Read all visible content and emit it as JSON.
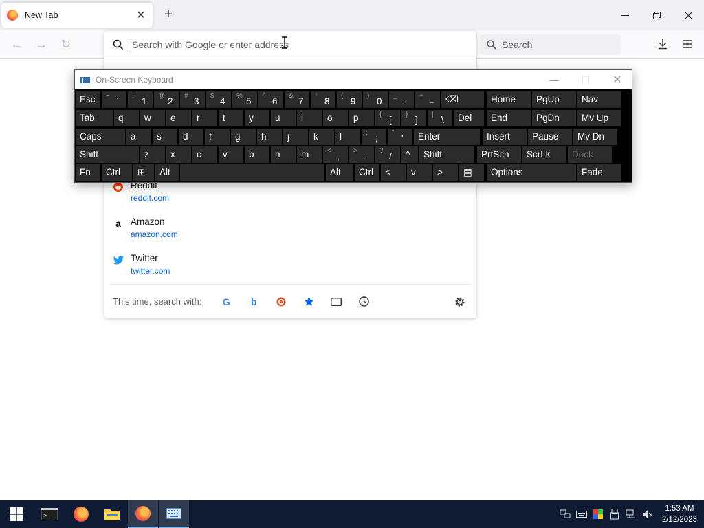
{
  "browser": {
    "tab_title": "New Tab",
    "url_placeholder": "Search with Google or enter address",
    "search_placeholder": "Search"
  },
  "suggestions": [
    {
      "name": "Reddit",
      "url": "reddit.com",
      "icon": "reddit-icon"
    },
    {
      "name": "Amazon",
      "url": "amazon.com",
      "icon": "amazon-icon"
    },
    {
      "name": "Twitter",
      "url": "twitter.com",
      "icon": "twitter-icon"
    }
  ],
  "oneoff": {
    "label": "This time, search with:",
    "engines": [
      "google-icon",
      "bing-icon",
      "duckduckgo-icon",
      "bookmarks-icon",
      "tabs-icon",
      "history-icon"
    ]
  },
  "osk": {
    "title": "On-Screen Keyboard",
    "rows": [
      [
        {
          "p": "Esc"
        },
        {
          "s": "~",
          "p": "`"
        },
        {
          "s": "!",
          "p": "1"
        },
        {
          "s": "@",
          "p": "2"
        },
        {
          "s": "#",
          "p": "3"
        },
        {
          "s": "$",
          "p": "4"
        },
        {
          "s": "%",
          "p": "5"
        },
        {
          "s": "^",
          "p": "6"
        },
        {
          "s": "&",
          "p": "7"
        },
        {
          "s": "*",
          "p": "8"
        },
        {
          "s": "(",
          "p": "9"
        },
        {
          "s": ")",
          "p": "0"
        },
        {
          "s": "_",
          "p": "-"
        },
        {
          "s": "+",
          "p": "="
        },
        {
          "p": "⌫"
        },
        {
          "p": "Home"
        },
        {
          "p": "PgUp"
        },
        {
          "p": "Nav"
        }
      ],
      [
        {
          "p": "Tab"
        },
        {
          "p": "q"
        },
        {
          "p": "w"
        },
        {
          "p": "e"
        },
        {
          "p": "r"
        },
        {
          "p": "t"
        },
        {
          "p": "y"
        },
        {
          "p": "u"
        },
        {
          "p": "i"
        },
        {
          "p": "o"
        },
        {
          "p": "p"
        },
        {
          "s": "{",
          "p": "["
        },
        {
          "s": "}",
          "p": "]"
        },
        {
          "s": "|",
          "p": "\\"
        },
        {
          "p": "Del"
        },
        {
          "p": "End"
        },
        {
          "p": "PgDn"
        },
        {
          "p": "Mv Up"
        }
      ],
      [
        {
          "p": "Caps"
        },
        {
          "p": "a"
        },
        {
          "p": "s"
        },
        {
          "p": "d"
        },
        {
          "p": "f"
        },
        {
          "p": "g"
        },
        {
          "p": "h"
        },
        {
          "p": "j"
        },
        {
          "p": "k"
        },
        {
          "p": "l"
        },
        {
          "s": ":",
          "p": ";"
        },
        {
          "s": "\"",
          "p": "'"
        },
        {
          "p": "Enter"
        },
        {
          "p": "Insert"
        },
        {
          "p": "Pause"
        },
        {
          "p": "Mv Dn"
        }
      ],
      [
        {
          "p": "Shift"
        },
        {
          "p": "z"
        },
        {
          "p": "x"
        },
        {
          "p": "c"
        },
        {
          "p": "v"
        },
        {
          "p": "b"
        },
        {
          "p": "n"
        },
        {
          "p": "m"
        },
        {
          "s": "<",
          "p": ","
        },
        {
          "s": ">",
          "p": "."
        },
        {
          "s": "?",
          "p": "/"
        },
        {
          "p": "^"
        },
        {
          "p": "Shift"
        },
        {
          "p": "PrtScn"
        },
        {
          "p": "ScrLk"
        },
        {
          "p": "Dock"
        }
      ],
      [
        {
          "p": "Fn"
        },
        {
          "p": "Ctrl"
        },
        {
          "p": "⊞"
        },
        {
          "p": "Alt"
        },
        {
          "p": ""
        },
        {
          "p": "Alt"
        },
        {
          "p": "Ctrl"
        },
        {
          "p": "<"
        },
        {
          "p": "v"
        },
        {
          "p": ">"
        },
        {
          "p": "▤"
        },
        {
          "p": "Options"
        },
        {
          "p": "Fade"
        }
      ]
    ]
  },
  "taskbar": {
    "time": "1:53 AM",
    "date": "2/12/2023"
  }
}
